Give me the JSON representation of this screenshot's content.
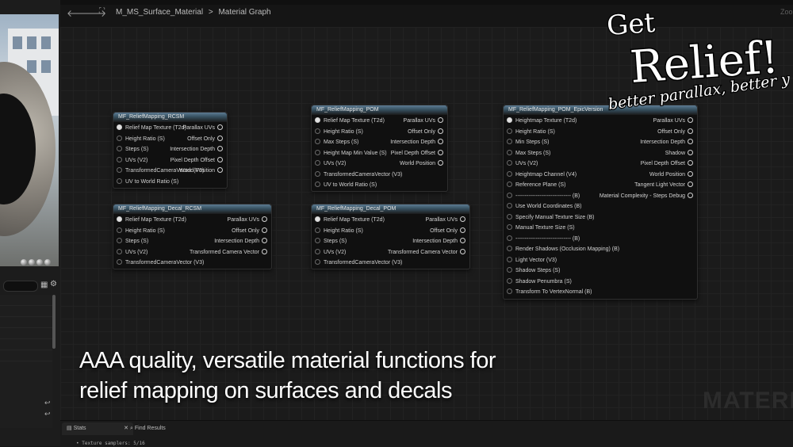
{
  "header": {
    "breadcrumb": [
      "M_MS_Surface_Material",
      "Material Graph"
    ],
    "separator": ">",
    "zoom_label": "Zoo"
  },
  "logo": {
    "line1": "Get",
    "line2": "Relief!",
    "tagline": "better parallax, better you"
  },
  "caption": {
    "line1": "AAA quality, versatile material functions for",
    "line2": "relief mapping on surfaces and decals"
  },
  "watermark": "MATERIA",
  "bottom": {
    "tabs": [
      {
        "label": "Stats",
        "icon": "stats-icon"
      },
      {
        "label": "Find Results",
        "icon": "search-icon"
      }
    ],
    "stats_line": "• Texture samplers: 5/16"
  },
  "nodes": [
    {
      "title": "MF_ReliefMapping_RCSM",
      "inputs": [
        "Relief Map Texture (T2d)",
        "Height Ratio (S)",
        "Steps (S)",
        "UVs (V2)",
        "TransformedCameraVector (V3)",
        "UV to World Ratio (S)"
      ],
      "outputs": [
        "Parallax UVs",
        "Offset Only",
        "Intersection Depth",
        "Pixel Depth Offset",
        "World Position"
      ]
    },
    {
      "title": "MF_ReliefMapping_POM",
      "inputs": [
        "Relief Map Texture (T2d)",
        "Height Ratio (S)",
        "Max Steps (S)",
        "Height Map Min Value (S)",
        "UVs (V2)",
        "TransformedCameraVector (V3)",
        "UV to World Ratio (S)"
      ],
      "outputs": [
        "Parallax UVs",
        "Offset Only",
        "Intersection Depth",
        "Pixel Depth Offset",
        "World Position"
      ]
    },
    {
      "title": "MF_ReliefMapping_POM_EpicVersion",
      "inputs": [
        "Heightmap Texture (T2d)",
        "Height Ratio (S)",
        "Min Steps (S)",
        "Max Steps (S)",
        "UVs (V2)",
        "Heightmap Channel (V4)",
        "Reference Plane (S)",
        "------------------------------ (B)",
        "Use World Coordinates (B)",
        "Specify Manual Texture Size (B)",
        "Manual Texture Size (S)",
        "------------------------------ (B)",
        "Render Shadows (Occlusion Mapping) (B)",
        "Light Vector (V3)",
        "Shadow Steps (S)",
        "Shadow Penumbra (S)",
        "Transform To VertexNormal (B)"
      ],
      "outputs": [
        "Parallax UVs",
        "Offset Only",
        "Intersection Depth",
        "Shadow",
        "Pixel Depth Offset",
        "World Position",
        "Tangent Light Vector",
        "Material Complexity - Steps Debug"
      ]
    },
    {
      "title": "MF_ReliefMapping_Decal_RCSM",
      "inputs": [
        "Relief Map Texture (T2d)",
        "Height Ratio (S)",
        "Steps (S)",
        "UVs (V2)",
        "TransformedCameraVector (V3)"
      ],
      "outputs": [
        "Parallax UVs",
        "Offset Only",
        "Intersection Depth",
        "Transformed Camera Vector"
      ]
    },
    {
      "title": "MF_ReliefMapping_Decal_POM",
      "inputs": [
        "Relief Map Texture (T2d)",
        "Height Ratio (S)",
        "Steps (S)",
        "UVs (V2)",
        "TransformedCameraVector (V3)"
      ],
      "outputs": [
        "Parallax UVs",
        "Offset Only",
        "Intersection Depth",
        "Transformed Camera Vector"
      ]
    }
  ]
}
